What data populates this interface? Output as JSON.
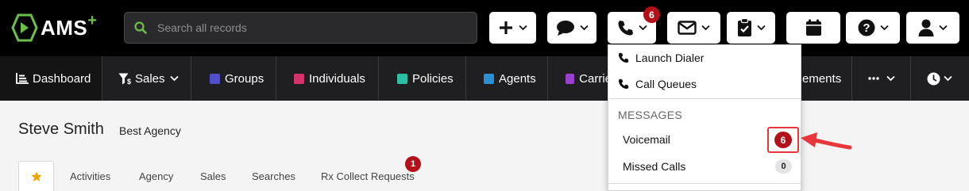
{
  "app": {
    "logo_text": "AMS",
    "logo_plus": "+",
    "brand_color": "#6cc04a"
  },
  "search": {
    "placeholder": "Search all records"
  },
  "toolbar": {
    "buttons": [
      {
        "icon": "plus-icon",
        "has_dropdown": true
      },
      {
        "icon": "chat-bubble-icon",
        "has_dropdown": true
      },
      {
        "icon": "phone-icon",
        "has_dropdown": true,
        "badge": "6"
      },
      {
        "icon": "envelope-icon",
        "has_dropdown": true
      },
      {
        "icon": "clipboard-check-icon",
        "has_dropdown": true
      },
      {
        "icon": "calendar-icon",
        "has_dropdown": false
      },
      {
        "icon": "help-circle-icon",
        "has_dropdown": true
      },
      {
        "icon": "user-icon",
        "has_dropdown": true
      }
    ]
  },
  "nav": {
    "items": [
      {
        "label": "Dashboard",
        "icon": "chart-icon",
        "active": true
      },
      {
        "label": "Sales",
        "icon": "filter-dollar-icon",
        "has_dropdown": true
      },
      {
        "label": "Groups",
        "color": "#4f4fc9"
      },
      {
        "label": "Individuals",
        "color": "#d6336c"
      },
      {
        "label": "Policies",
        "color": "#2bbfa6"
      },
      {
        "label": "Agents",
        "color": "#2b8fd6"
      },
      {
        "label": "Carrie",
        "color": "#9b3fd1"
      },
      {
        "label": "ements"
      },
      {
        "label": "",
        "icon": "more-dots-icon",
        "has_dropdown": true
      },
      {
        "label": "",
        "icon": "clock-icon",
        "has_dropdown": true
      }
    ]
  },
  "profile": {
    "name": "Steve Smith",
    "agency": "Best Agency"
  },
  "tabs": [
    {
      "label": "",
      "icon": "star-icon",
      "active": true
    },
    {
      "label": "Activities"
    },
    {
      "label": "Agency"
    },
    {
      "label": "Sales"
    },
    {
      "label": "Searches"
    },
    {
      "label": "Rx Collect Requests",
      "badge": "1"
    }
  ],
  "phone_menu": {
    "items": [
      {
        "label": "Launch Dialer",
        "icon": "phone-icon"
      },
      {
        "label": "Call Queues",
        "icon": "phone-icon"
      }
    ],
    "section_header": "MESSAGES",
    "messages": [
      {
        "label": "Voicemail",
        "badge": "6",
        "highlighted": true
      },
      {
        "label": "Missed Calls",
        "badge": "0"
      }
    ]
  },
  "colors": {
    "alert_badge": "#b3101a",
    "highlight_outline": "#e8363a",
    "annotation_arrow": "#e8363a"
  }
}
